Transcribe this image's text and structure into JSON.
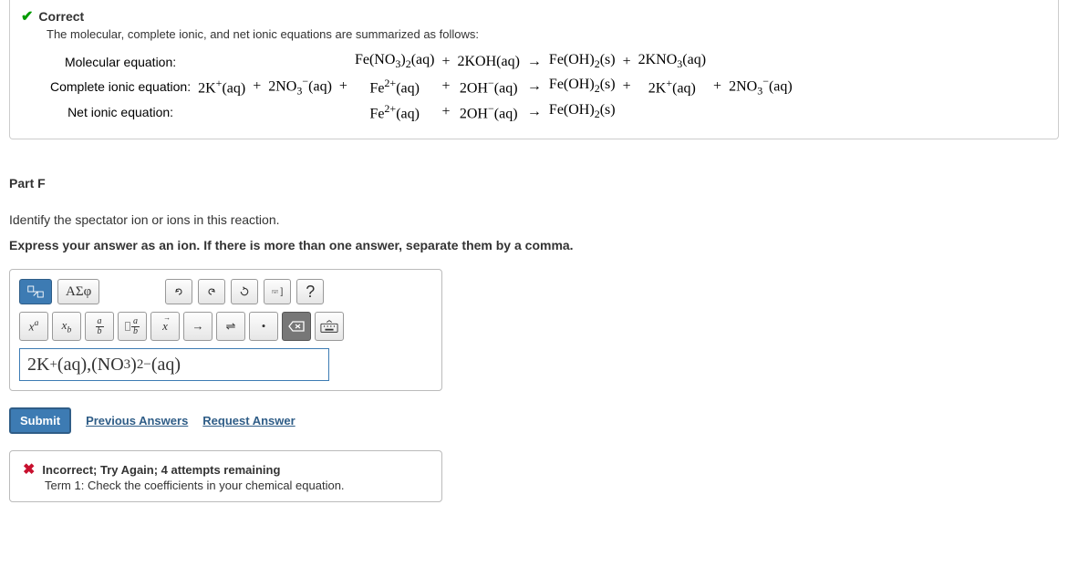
{
  "correct": {
    "label": "Correct",
    "summary": "The molecular, complete ionic, and net ionic equations are summarized as follows:",
    "row1_label": "Molecular equation:",
    "row2_label": "Complete ionic equation:",
    "row3_label": "Net ionic equation:"
  },
  "part": {
    "header": "Part F",
    "question": "Identify the spectator ion or ions in this reaction.",
    "instruction": "Express your answer as an ion. If there is more than one answer, separate them by a comma."
  },
  "toolbar": {
    "greek": "ΑΣφ",
    "help": "?"
  },
  "answer_value_html": "2K<span class='sup'>+</span>(aq),(NO<span class='sub'>3</span>)<span class='sub'>2</span><span class='sup'>−</span>(aq)",
  "actions": {
    "submit": "Submit",
    "previous": "Previous Answers",
    "request": "Request Answer"
  },
  "incorrect": {
    "header": "Incorrect; Try Again; 4 attempts remaining",
    "detail": "Term 1: Check the coefficients in your chemical equation."
  },
  "eq": {
    "r1c5": "Fe(NO<span class='sub'>3</span>)<span class='sub'>2</span>(aq)",
    "r1c6": "+",
    "r1c7": "2KOH(aq)",
    "r1c8": "→",
    "r1c9": "Fe(OH)<span class='sub'>2</span>(s)",
    "r1c10": "+",
    "r1c11": "2KNO<span class='sub'>3</span>(aq)",
    "r2c1": "2K<span class='sup'>+</span>(aq)",
    "r2c2": "+",
    "r2c3": "2NO<span class='sub'>3</span><span class='sup'>−</span>(aq)",
    "r2c4": "+",
    "r2c5": "Fe<span class='sup'>2+</span>(aq)",
    "r2c6": "+",
    "r2c7": "2OH<span class='sup'>−</span>(aq)",
    "r2c8": "→",
    "r2c9": "Fe(OH)<span class='sub'>2</span>(s)",
    "r2c10": "+",
    "r2c11": "2K<span class='sup'>+</span>(aq)",
    "r2c12": "+",
    "r2c13": "2NO<span class='sub'>3</span><span class='sup'>−</span>(aq)",
    "r3c5": "Fe<span class='sup'>2+</span>(aq)",
    "r3c6": "+",
    "r3c7": "2OH<span class='sup'>−</span>(aq)",
    "r3c8": "→",
    "r3c9": "Fe(OH)<span class='sub'>2</span>(s)"
  }
}
